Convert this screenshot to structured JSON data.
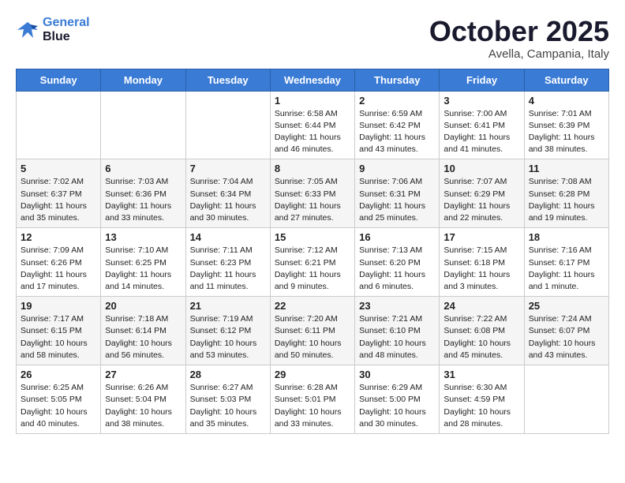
{
  "header": {
    "logo_line1": "General",
    "logo_line2": "Blue",
    "month": "October 2025",
    "location": "Avella, Campania, Italy"
  },
  "days_of_week": [
    "Sunday",
    "Monday",
    "Tuesday",
    "Wednesday",
    "Thursday",
    "Friday",
    "Saturday"
  ],
  "weeks": [
    [
      {
        "day": "",
        "info": ""
      },
      {
        "day": "",
        "info": ""
      },
      {
        "day": "",
        "info": ""
      },
      {
        "day": "1",
        "info": "Sunrise: 6:58 AM\nSunset: 6:44 PM\nDaylight: 11 hours and 46 minutes."
      },
      {
        "day": "2",
        "info": "Sunrise: 6:59 AM\nSunset: 6:42 PM\nDaylight: 11 hours and 43 minutes."
      },
      {
        "day": "3",
        "info": "Sunrise: 7:00 AM\nSunset: 6:41 PM\nDaylight: 11 hours and 41 minutes."
      },
      {
        "day": "4",
        "info": "Sunrise: 7:01 AM\nSunset: 6:39 PM\nDaylight: 11 hours and 38 minutes."
      }
    ],
    [
      {
        "day": "5",
        "info": "Sunrise: 7:02 AM\nSunset: 6:37 PM\nDaylight: 11 hours and 35 minutes."
      },
      {
        "day": "6",
        "info": "Sunrise: 7:03 AM\nSunset: 6:36 PM\nDaylight: 11 hours and 33 minutes."
      },
      {
        "day": "7",
        "info": "Sunrise: 7:04 AM\nSunset: 6:34 PM\nDaylight: 11 hours and 30 minutes."
      },
      {
        "day": "8",
        "info": "Sunrise: 7:05 AM\nSunset: 6:33 PM\nDaylight: 11 hours and 27 minutes."
      },
      {
        "day": "9",
        "info": "Sunrise: 7:06 AM\nSunset: 6:31 PM\nDaylight: 11 hours and 25 minutes."
      },
      {
        "day": "10",
        "info": "Sunrise: 7:07 AM\nSunset: 6:29 PM\nDaylight: 11 hours and 22 minutes."
      },
      {
        "day": "11",
        "info": "Sunrise: 7:08 AM\nSunset: 6:28 PM\nDaylight: 11 hours and 19 minutes."
      }
    ],
    [
      {
        "day": "12",
        "info": "Sunrise: 7:09 AM\nSunset: 6:26 PM\nDaylight: 11 hours and 17 minutes."
      },
      {
        "day": "13",
        "info": "Sunrise: 7:10 AM\nSunset: 6:25 PM\nDaylight: 11 hours and 14 minutes."
      },
      {
        "day": "14",
        "info": "Sunrise: 7:11 AM\nSunset: 6:23 PM\nDaylight: 11 hours and 11 minutes."
      },
      {
        "day": "15",
        "info": "Sunrise: 7:12 AM\nSunset: 6:21 PM\nDaylight: 11 hours and 9 minutes."
      },
      {
        "day": "16",
        "info": "Sunrise: 7:13 AM\nSunset: 6:20 PM\nDaylight: 11 hours and 6 minutes."
      },
      {
        "day": "17",
        "info": "Sunrise: 7:15 AM\nSunset: 6:18 PM\nDaylight: 11 hours and 3 minutes."
      },
      {
        "day": "18",
        "info": "Sunrise: 7:16 AM\nSunset: 6:17 PM\nDaylight: 11 hours and 1 minute."
      }
    ],
    [
      {
        "day": "19",
        "info": "Sunrise: 7:17 AM\nSunset: 6:15 PM\nDaylight: 10 hours and 58 minutes."
      },
      {
        "day": "20",
        "info": "Sunrise: 7:18 AM\nSunset: 6:14 PM\nDaylight: 10 hours and 56 minutes."
      },
      {
        "day": "21",
        "info": "Sunrise: 7:19 AM\nSunset: 6:12 PM\nDaylight: 10 hours and 53 minutes."
      },
      {
        "day": "22",
        "info": "Sunrise: 7:20 AM\nSunset: 6:11 PM\nDaylight: 10 hours and 50 minutes."
      },
      {
        "day": "23",
        "info": "Sunrise: 7:21 AM\nSunset: 6:10 PM\nDaylight: 10 hours and 48 minutes."
      },
      {
        "day": "24",
        "info": "Sunrise: 7:22 AM\nSunset: 6:08 PM\nDaylight: 10 hours and 45 minutes."
      },
      {
        "day": "25",
        "info": "Sunrise: 7:24 AM\nSunset: 6:07 PM\nDaylight: 10 hours and 43 minutes."
      }
    ],
    [
      {
        "day": "26",
        "info": "Sunrise: 6:25 AM\nSunset: 5:05 PM\nDaylight: 10 hours and 40 minutes."
      },
      {
        "day": "27",
        "info": "Sunrise: 6:26 AM\nSunset: 5:04 PM\nDaylight: 10 hours and 38 minutes."
      },
      {
        "day": "28",
        "info": "Sunrise: 6:27 AM\nSunset: 5:03 PM\nDaylight: 10 hours and 35 minutes."
      },
      {
        "day": "29",
        "info": "Sunrise: 6:28 AM\nSunset: 5:01 PM\nDaylight: 10 hours and 33 minutes."
      },
      {
        "day": "30",
        "info": "Sunrise: 6:29 AM\nSunset: 5:00 PM\nDaylight: 10 hours and 30 minutes."
      },
      {
        "day": "31",
        "info": "Sunrise: 6:30 AM\nSunset: 4:59 PM\nDaylight: 10 hours and 28 minutes."
      },
      {
        "day": "",
        "info": ""
      }
    ]
  ]
}
